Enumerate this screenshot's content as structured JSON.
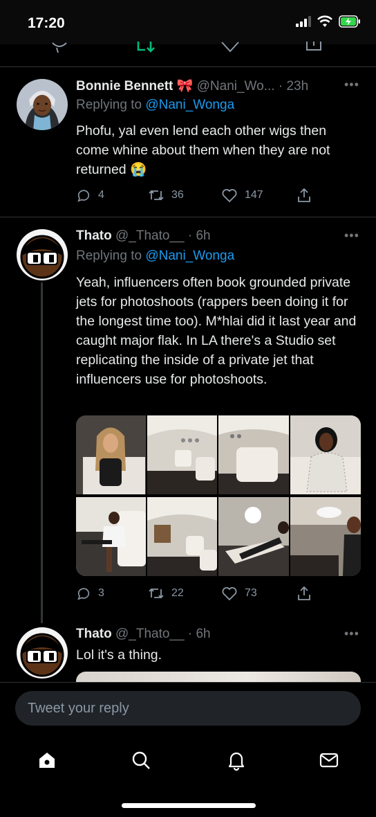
{
  "status_bar": {
    "time": "17:20"
  },
  "tweets": [
    {
      "name": "Bonnie Bennett",
      "handle": "@Nani_Wo...",
      "time": "· 23h",
      "reply_prefix": "Replying to ",
      "reply_to": "@Nani_Wonga",
      "text": "Phofu, yal even lend each other wigs then come whine about them when they are not returned 😭",
      "replies": "4",
      "retweets": "36",
      "likes": "147"
    },
    {
      "name": "Thato",
      "handle": "@_Thato__",
      "time": "· 6h",
      "reply_prefix": "Replying to ",
      "reply_to": "@Nani_Wonga",
      "text": "Yeah, influencers often book grounded private jets for photoshoots (rappers been doing it for the longest time too). M*hlai did it last year and caught major flak. In LA there's a Studio set replicating the inside of a private jet that influencers use for photoshoots.",
      "replies": "3",
      "retweets": "22",
      "likes": "73"
    },
    {
      "name": "Thato",
      "handle": "@_Thato__",
      "time": "· 6h",
      "text": "Lol it's a thing."
    }
  ],
  "reply_bar": {
    "placeholder": "Tweet your reply"
  },
  "icons": {
    "reply": "comment-icon",
    "retweet": "retweet-icon",
    "like": "heart-icon",
    "share": "share-icon",
    "home": "home-icon",
    "search": "search-icon",
    "notifications": "bell-icon",
    "messages": "mail-icon"
  },
  "colors": {
    "background": "#000000",
    "accent": "#1d9bf0",
    "muted": "#71767b",
    "retweet_green": "#00ba7c"
  }
}
